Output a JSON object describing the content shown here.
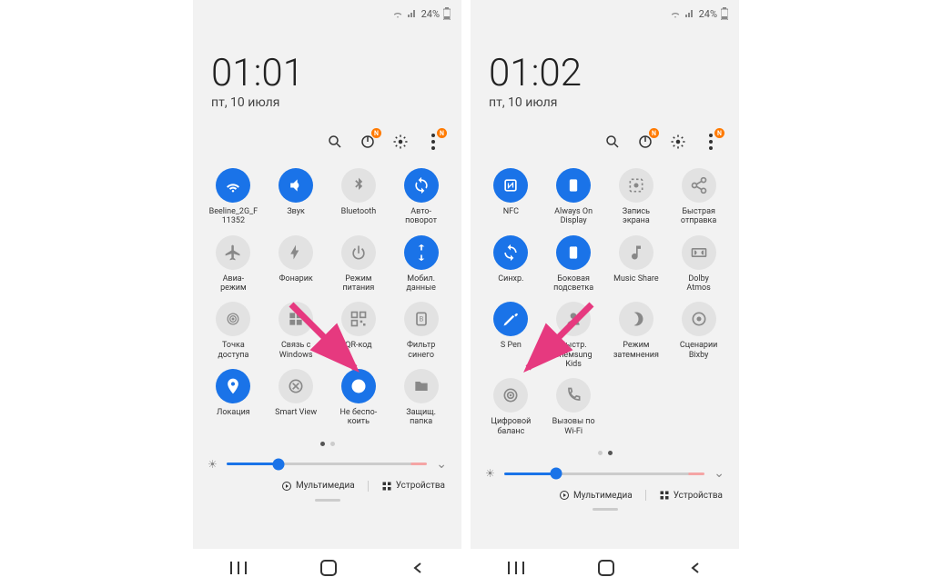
{
  "screens": [
    {
      "status": {
        "battery": "24%"
      },
      "clock": "01:01",
      "date": "пт, 10 июля",
      "page_indicator": {
        "count": 2,
        "active": 0
      },
      "tiles": [
        {
          "id": "wifi",
          "label": "Beeline_2G_F\n11352",
          "active": true,
          "icon": "wifi"
        },
        {
          "id": "sound",
          "label": "Звук",
          "active": true,
          "icon": "volume"
        },
        {
          "id": "bluetooth",
          "label": "Bluetooth",
          "active": false,
          "icon": "bluetooth"
        },
        {
          "id": "autorotate",
          "label": "Авто-\nповорот",
          "active": true,
          "icon": "rotate"
        },
        {
          "id": "airplane",
          "label": "Авиа-\nрежим",
          "active": false,
          "icon": "plane"
        },
        {
          "id": "flashlight",
          "label": "Фонарик",
          "active": false,
          "icon": "flash"
        },
        {
          "id": "powermode",
          "label": "Режим\nпитания",
          "active": false,
          "icon": "power"
        },
        {
          "id": "mobiledata",
          "label": "Мобил.\nданные",
          "active": true,
          "icon": "data"
        },
        {
          "id": "hotspot",
          "label": "Точка\nдоступа",
          "active": false,
          "icon": "hotspot"
        },
        {
          "id": "link-windows",
          "label": "Связь с\nWindows",
          "active": false,
          "icon": "windows"
        },
        {
          "id": "qr",
          "label": "QR-код",
          "active": false,
          "icon": "qr"
        },
        {
          "id": "bluelight",
          "label": "Фильтр\nсинего",
          "active": false,
          "icon": "bluefilter"
        },
        {
          "id": "location",
          "label": "Локация",
          "active": true,
          "icon": "pin"
        },
        {
          "id": "smartview",
          "label": "Smart View",
          "active": false,
          "icon": "smartview"
        },
        {
          "id": "dnd",
          "label": "Не беспо-\nкоить",
          "active": true,
          "icon": "dnd"
        },
        {
          "id": "securefolder",
          "label": "Защищ.\nпапка",
          "active": false,
          "icon": "folder"
        }
      ]
    },
    {
      "status": {
        "battery": "24%"
      },
      "clock": "01:02",
      "date": "пт, 10 июля",
      "page_indicator": {
        "count": 2,
        "active": 1
      },
      "tiles": [
        {
          "id": "nfc",
          "label": "NFC",
          "active": true,
          "icon": "nfc"
        },
        {
          "id": "aod",
          "label": "Always On\nDisplay",
          "active": true,
          "icon": "aod"
        },
        {
          "id": "screenrec",
          "label": "Запись\nэкрана",
          "active": false,
          "icon": "record"
        },
        {
          "id": "quickshare",
          "label": "Быстрая\nотправка",
          "active": false,
          "icon": "share"
        },
        {
          "id": "sync",
          "label": "Синхр.",
          "active": true,
          "icon": "sync"
        },
        {
          "id": "edge",
          "label": "Боковая\nподсветка",
          "active": true,
          "icon": "edge"
        },
        {
          "id": "musicshare",
          "label": "Music Share",
          "active": false,
          "icon": "music"
        },
        {
          "id": "dolby",
          "label": "Dolby\nAtmos",
          "active": false,
          "icon": "dolby"
        },
        {
          "id": "spen",
          "label": "S Pen",
          "active": true,
          "icon": "spen"
        },
        {
          "id": "fastcharge",
          "label": "Быстр. chемsung\nKids",
          "active": false,
          "icon": "kids"
        },
        {
          "id": "dimmode",
          "label": "Режим\nзатемнения",
          "active": false,
          "icon": "dim"
        },
        {
          "id": "bixby",
          "label": "Сценарии\nBixby",
          "active": false,
          "icon": "bixby"
        },
        {
          "id": "digitalbal",
          "label": "Цифровой\nбаланс",
          "active": false,
          "icon": "digital"
        },
        {
          "id": "wificall",
          "label": "Вызовы по\nWi-Fi",
          "active": false,
          "icon": "wificall"
        }
      ]
    }
  ],
  "bottom": {
    "multimedia": "Мультимедиа",
    "devices": "Устройства"
  },
  "icons": {
    "wifi": "<path d='M12 18c.8 0 1.5.7 1.5 1.5S12.8 21 12 21s-1.5-.7-1.5-1.5S11.2 18 12 18zm0-4c2 0 3.8.8 5 2.2l-1.7 1.7c-.8-.9-2-1.5-3.3-1.5s-2.5.6-3.3 1.5L7 16.2C8.2 14.8 10 14 12 14zm0-4c3.3 0 6.3 1.4 8.4 3.6l-1.7 1.7C17 13.5 14.6 12.4 12 12.4S7 13.5 5.3 15.3L3.6 13.6C5.7 11.4 8.7 10 12 10z' fill='currentColor'/>",
    "volume": "<path d='M5 9v6h4l5 5V4L9 9H5zm11 3c0-1.8-1-3.3-2.5-4v8c1.5-.7 2.5-2.2 2.5-4z' fill='currentColor'/>",
    "bluetooth": "<path d='M12 2l5 5-3 3 3 3-5 5v-6l-3 3-1.5-1.5L11 10 7.5 6.5 9 5l3 3V2z' fill='currentColor'/>",
    "rotate": "<path d='M12 4V1L8 5l4 4V6c3.3 0 6 2.7 6 6 0 1-.3 2-.7 2.8l1.5 1.5C19.5 15 20 13.6 20 12c0-4.4-3.6-8-8-8zm0 14c-3.3 0-6-2.7-6-6 0-1 .3-2 .7-2.8L5.2 7.7C4.5 9 4 10.4 4 12c0 4.4 3.6 8 8 8v3l4-4-4-4v3z' fill='currentColor'/>",
    "plane": "<path d='M21 16v-2l-8-5V3.5C13 2.7 12.3 2 11.5 2S10 2.7 10 3.5V9l-8 5v2l8-2.5V19l-2 1.5V22l3.5-1 3.5 1v-1.5L13 19v-5.5l8 2.5z' fill='currentColor'/>",
    "flash": "<path d='M9 21v-7H5l7-12v7h4L9 21z' fill='currentColor'/>",
    "power": "<path d='M11 3h2v10h-2zM7 6l1.5 1.5C7 9 6 10.9 6 13c0 3.3 2.7 6 6 6s6-2.7 6-6c0-2.1-1-4-2.5-5.5L17 6c2 1.8 3 4.3 3 7 0 4.4-3.6 8-8 8s-8-3.6-8-8c0-2.7 1-5.2 3-7z' fill='currentColor'/>",
    "data": "<path d='M8 4l4-3 4 3h-3v5h-2V4H8zm8 16l-4 3-4-3h3v-5h2v5h3z' fill='currentColor'/>",
    "hotspot": "<path d='M12 11c.6 0 1 .4 1 1s-.4 1-1 1-1-.4-1-1 .4-1 1-1zm-4 1c0 2.2 1.8 4 4 4s4-1.8 4-4-1.8-4-4-4-4 1.8-4 4zm-3 0c0 3.9 3.1 7 7 7s7-3.1 7-7-3.1-7-7-7-7 3.1-7 7z' fill='none' stroke='currentColor' stroke-width='1.5'/>",
    "windows": "<rect x='4' y='4' width='7' height='7' fill='currentColor'/><rect x='13' y='4' width='7' height='7' fill='currentColor'/><rect x='4' y='13' width='7' height='7' fill='currentColor'/><rect x='13' y='13' width='7' height='7' fill='currentColor'/>",
    "qr": "<rect x='3' y='3' width='7' height='7' fill='none' stroke='currentColor' stroke-width='2'/><rect x='14' y='3' width='7' height='7' fill='none' stroke='currentColor' stroke-width='2'/><rect x='3' y='14' width='7' height='7' fill='none' stroke='currentColor' stroke-width='2'/><rect x='14' y='14' width='3' height='3' fill='currentColor'/><rect x='18' y='18' width='3' height='3' fill='currentColor'/>",
    "bluefilter": "<rect x='6' y='4' width='12' height='16' rx='2' fill='none' stroke='currentColor' stroke-width='2'/><text x='12' y='15' font-size='9' text-anchor='middle' fill='currentColor'>B</text>",
    "pin": "<path d='M12 2C8.1 2 5 5.1 5 9c0 5.3 7 13 7 13s7-7.7 7-13c0-3.9-3.1-7-7-7zm0 9.5c-1.4 0-2.5-1.1-2.5-2.5S10.6 6.5 12 6.5s2.5 1.1 2.5 2.5S13.4 11.5 12 11.5z' fill='currentColor'/>",
    "smartview": "<path d='M12 4c4.4 0 8 3.6 8 8s-3.6 8-8 8-8-3.6-8-8 3.6-8 8-8z' fill='none' stroke='currentColor' stroke-width='2'/><path d='M8 8l8 8M16 8l-8 8' stroke='currentColor' stroke-width='2'/>",
    "dnd": "<circle cx='12' cy='12' r='9' fill='currentColor'/><rect x='7' y='11' width='10' height='2' fill='#fff'/>",
    "folder": "<path d='M4 6h6l2 2h8v10H4V6z' fill='currentColor'/>",
    "nfc": "<rect x='5' y='5' width='14' height='14' rx='2' fill='none' stroke='currentColor' stroke-width='2'/><path d='M9 9v6l6-6v6' fill='none' stroke='currentColor' stroke-width='1.5'/>",
    "aod": "<rect x='7' y='4' width='10' height='16' rx='2' fill='currentColor'/><rect x='9' y='6' width='6' height='10' fill='#fff'/>",
    "record": "<rect x='4' y='4' width='16' height='16' rx='2' fill='none' stroke='currentColor' stroke-width='2' stroke-dasharray='3 3'/><circle cx='12' cy='12' r='3' fill='currentColor'/>",
    "share": "<circle cx='18' cy='5' r='3' fill='none' stroke='currentColor' stroke-width='2'/><circle cx='6' cy='12' r='3' fill='none' stroke='currentColor' stroke-width='2'/><circle cx='18' cy='19' r='3' fill='none' stroke='currentColor' stroke-width='2'/><path d='M8.6 10.6l6.8-4M8.6 13.4l6.8 4' stroke='currentColor' stroke-width='2'/>",
    "sync": "<path d='M12 4V1L8 5l4 4V6c3.3 0 6 2.7 6 6h2c0-4.4-3.6-8-8-8zm0 14c-3.3 0-6-2.7-6-6H4c0 4.4 3.6 8 8 8v3l4-4-4-4v3z' fill='currentColor'/>",
    "edge": "<rect x='7' y='4' width='10' height='16' rx='2' fill='currentColor'/><path d='M15 4v16' stroke='#fff' stroke-width='1'/>",
    "music": "<path d='M12 3v10.6c-.6-.4-1.3-.6-2-.6-2.2 0-4 1.8-4 4s1.8 4 4 4 4-1.8 4-4V7h4V3h-6z' fill='currentColor'/>",
    "dolby": "<rect x='3' y='7' width='18' height='10' rx='1' fill='none' stroke='currentColor' stroke-width='2'/><path d='M6 9v6c1.7 0 3-1.3 3-3s-1.3-3-3-3zm12 0c-1.7 0-3 1.3-3 3s1.3 3 3 3V9z' fill='currentColor'/>",
    "spen": "<path d='M3 21l3-1 11-11-2-2L4 18l-1 3zm14-14l2 2 2-2c.5-.5.5-1.5 0-2s-1.5-.5-2 0l-2 2z' fill='currentColor'/>",
    "kids": "<circle cx='12' cy='8' r='4' fill='currentColor'/><path d='M4 20c0-4 3.6-6 8-6s8 2 8 6' fill='currentColor'/>",
    "dim": "<path d='M12 3c5 0 9 4 9 9s-4 9-9 9c-1 0-2-.2-3-.5 3.5-1 6-4.5 6-8.5s-2.5-7.5-6-8.5c1-.3 2-.5 3-.5z' fill='currentColor'/>",
    "bixby": "<circle cx='12' cy='12' r='8' fill='none' stroke='currentColor' stroke-width='2'/><circle cx='12' cy='12' r='3' fill='currentColor'/>",
    "digital": "<circle cx='12' cy='12' r='8' fill='none' stroke='currentColor' stroke-width='2'/><circle cx='12' cy='12' r='4' fill='none' stroke='currentColor' stroke-width='2'/><circle cx='12' cy='12' r='1.5' fill='currentColor'/>",
    "wificall": "<path d='M6 4c0 8 6 14 14 14v-4l-4-1-2 2c-3-1-5-3-6-6l2-2-1-4H6z' fill='none' stroke='currentColor' stroke-width='2'/>"
  }
}
